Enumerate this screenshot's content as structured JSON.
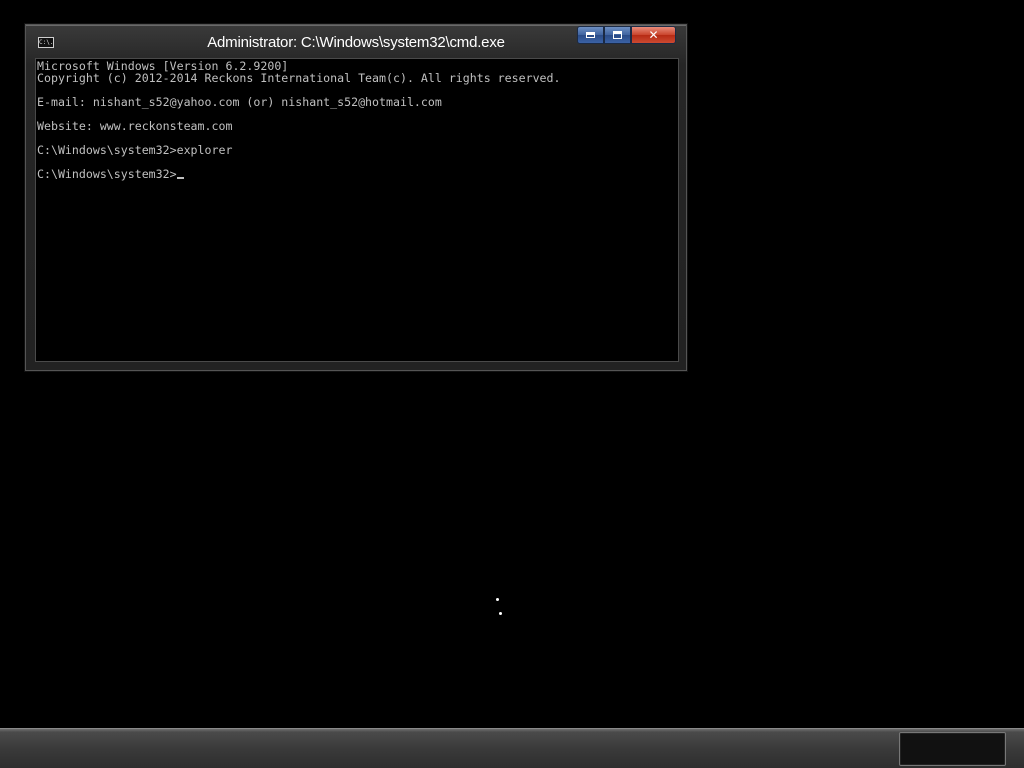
{
  "window": {
    "title": "Administrator: C:\\Windows\\system32\\cmd.exe",
    "icon": "cmd-icon",
    "icon_text": "C:\\."
  },
  "caption_buttons": {
    "minimize_icon": "minimize-icon",
    "maximize_icon": "maximize-icon",
    "close_symbol": "✕"
  },
  "console": {
    "lines": [
      "Microsoft Windows [Version 6.2.9200]",
      "Copyright (c) 2012-2014 Reckons International Team(c). All rights reserved.",
      "",
      "E-mail: nishant_s52@yahoo.com (or) nishant_s52@hotmail.com",
      "",
      "Website: www.reckonsteam.com",
      "",
      "C:\\Windows\\system32>explorer",
      "",
      "C:\\Windows\\system32>"
    ],
    "text_color": "#c0c0c0",
    "background": "#000000"
  },
  "colors": {
    "desktop": "#000000",
    "close_button": "#c9442c",
    "caption_button": "#3f63a0"
  }
}
